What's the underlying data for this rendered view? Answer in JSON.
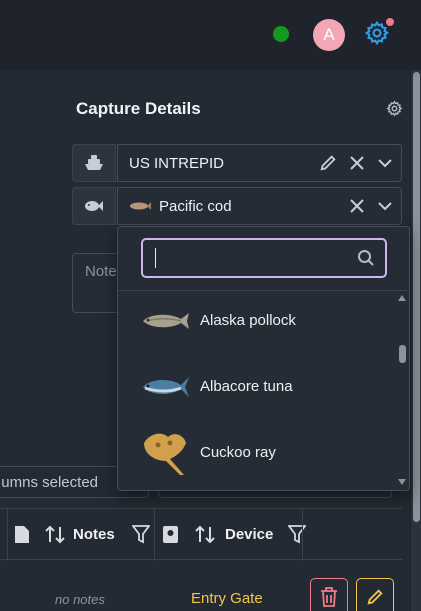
{
  "topbar": {
    "avatar_initial": "A",
    "status_color": "#139a1e",
    "notification_color": "#f07a8a",
    "accent_color": "#2f9de4"
  },
  "capture": {
    "title": "Capture Details",
    "vessel": {
      "icon": "ship-icon",
      "value": "US INTREPID"
    },
    "species": {
      "icon": "fish-icon",
      "value": "Pacific cod"
    },
    "notes_placeholder": "Note"
  },
  "dropdown": {
    "search_value": "",
    "items": [
      {
        "label": "Alaska pollock",
        "icon": "pollock-fish-image"
      },
      {
        "label": "Albacore tuna",
        "icon": "tuna-fish-image"
      },
      {
        "label": "Cuckoo ray",
        "icon": "ray-fish-image"
      }
    ]
  },
  "table": {
    "columns_selected_text": "umns selected",
    "headers": {
      "notes": "Notes",
      "device": "Device"
    },
    "row": {
      "notes": "no notes",
      "device": "Entry Gate"
    }
  }
}
